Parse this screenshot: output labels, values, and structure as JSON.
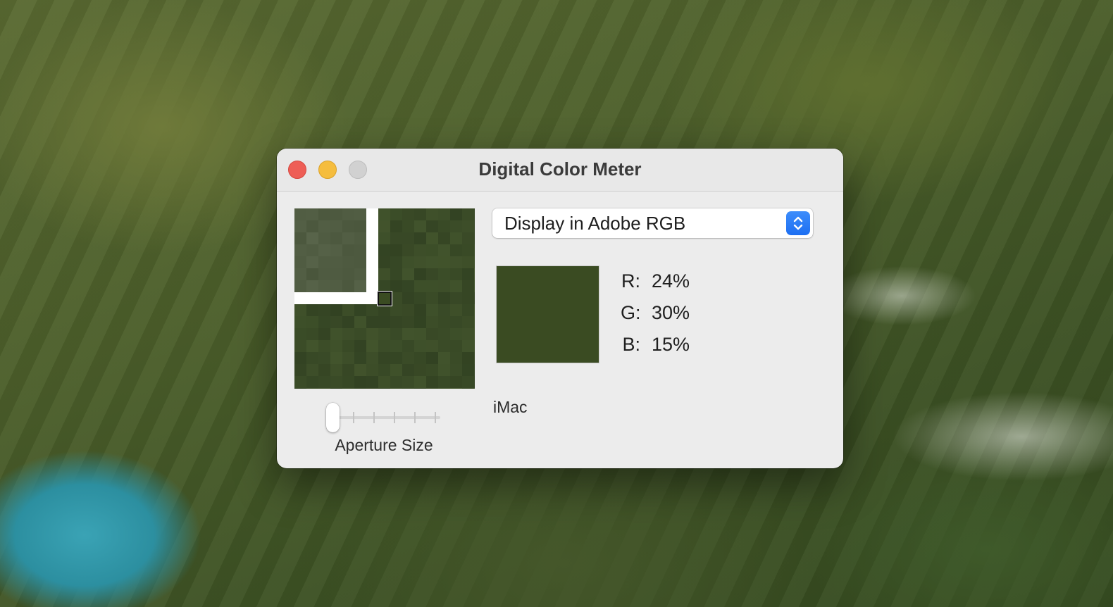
{
  "window": {
    "title": "Digital Color Meter"
  },
  "popup": {
    "selected": "Display in Adobe RGB"
  },
  "color": {
    "swatch_hex": "#3a4b22",
    "r_label": "R:",
    "r_value": "24%",
    "g_label": "G:",
    "g_value": "30%",
    "b_label": "B:",
    "b_value": "15%"
  },
  "display_name": "iMac",
  "aperture": {
    "label": "Aperture Size",
    "level": 0
  },
  "icons": [
    "close-icon",
    "minimize-icon",
    "zoom-icon",
    "up-down-chevron-icon"
  ]
}
